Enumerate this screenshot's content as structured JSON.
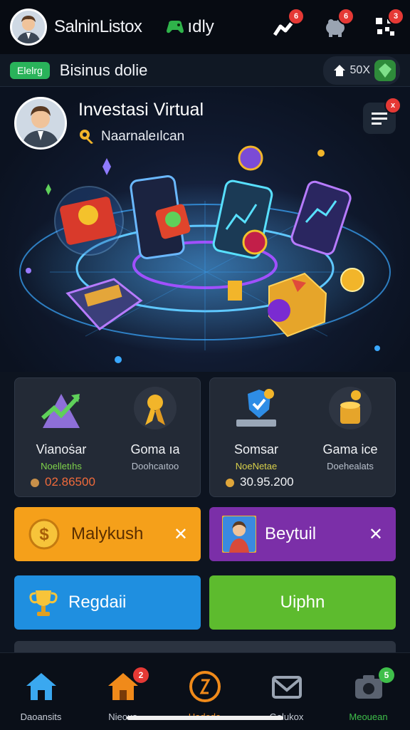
{
  "header": {
    "brand": "SalninListox",
    "daily_label": "ıdlу",
    "icons": [
      {
        "name": "chart-icon",
        "badge": "6"
      },
      {
        "name": "piggy-bank-icon",
        "badge": "6"
      },
      {
        "name": "qr-icon",
        "badge": "3"
      }
    ]
  },
  "subbar": {
    "tag": "Elelrg",
    "title": "Bisinus dolie",
    "pill_text": "50X"
  },
  "hero": {
    "title": "Investasi Virtual",
    "subtitle": "Naarnaleılcan",
    "menu_badge": "x"
  },
  "stats": [
    {
      "left": {
        "label": "Vianoṡar",
        "sub": "Noelletıhs",
        "value": "02.86500"
      },
      "right": {
        "label": "Goma ıa",
        "sub": "Doohcaıtoo"
      }
    },
    {
      "left": {
        "label": "Somsar",
        "sub": "NoeNetae",
        "value": "30.95.200"
      },
      "right": {
        "label": "Gama ice",
        "sub": "Doehealats"
      }
    }
  ],
  "actions": {
    "mulykush": {
      "label": "Malykush",
      "close": "✕"
    },
    "beytuil": {
      "label": "Beytuil",
      "close": "✕"
    },
    "regdaii": {
      "label": "Regdaii"
    },
    "uiphn": {
      "label": "Uiphn"
    }
  },
  "nav": [
    {
      "label": "Daoansits",
      "icon": "home-icon"
    },
    {
      "label": "Nieous",
      "icon": "shop-icon",
      "badge": "2"
    },
    {
      "label": "Hadoda",
      "icon": "coin-icon"
    },
    {
      "label": "Gelukox",
      "icon": "mail-icon"
    },
    {
      "label": "Meouean",
      "icon": "camera-icon",
      "badge": "5"
    }
  ],
  "colors": {
    "accent_green": "#29b35a",
    "orange": "#f5a01a",
    "purple": "#7b2fa8",
    "blue": "#1f8fe0",
    "lime": "#5dbb2e"
  }
}
